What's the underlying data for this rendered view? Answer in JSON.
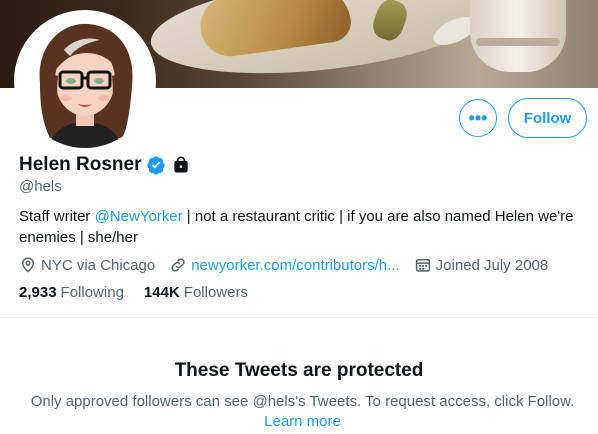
{
  "profile": {
    "name": "Helen Rosner",
    "handle": "@hels",
    "bio_prefix": "Staff writer ",
    "bio_mention": "@NewYorker",
    "bio_suffix": " | not a restaurant critic | if you are also named Helen we're enemies | she/her",
    "location": "NYC via Chicago",
    "website": "newyorker.com/contributors/h...",
    "joined": "Joined July 2008",
    "following_count": "2,933",
    "following_label": "Following",
    "followers_count": "144K",
    "followers_label": "Followers",
    "verified": true,
    "protected_account": true
  },
  "actions": {
    "more_label": "•••",
    "follow_label": "Follow"
  },
  "protected": {
    "title": "These Tweets are protected",
    "text": "Only approved followers can see @hels's Tweets. To request access, click Follow.",
    "learn_more": "Learn more"
  },
  "icons": {
    "verified": "verified-badge-icon",
    "lock": "lock-icon",
    "location": "location-pin-icon",
    "link": "link-icon",
    "calendar": "calendar-icon"
  },
  "colors": {
    "accent": "#1d9bf0",
    "text_primary": "#0f1419",
    "text_secondary": "#536471"
  }
}
